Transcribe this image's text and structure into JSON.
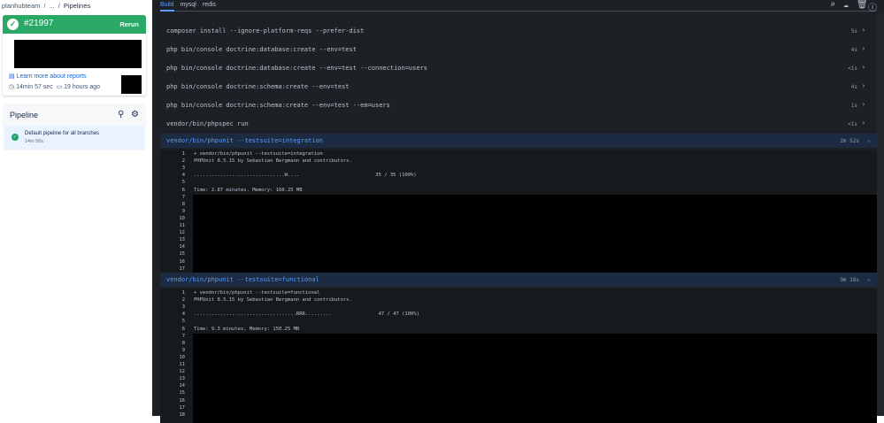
{
  "breadcrumb": [
    "planhubteam",
    "/",
    "...",
    "/",
    "Pipelines"
  ],
  "build": {
    "number": "#21997",
    "rerun": "Rerun",
    "learn": "Learn more about reports",
    "duration": "14min 57 sec",
    "ago": "19 hours ago"
  },
  "pipeline": {
    "title": "Pipeline",
    "item": "Default pipeline for all branches",
    "item_time": "14m 56s"
  },
  "tabs": [
    "Build",
    "mysql",
    "redis"
  ],
  "commands": [
    {
      "cmd": "composer install --ignore-platform-reqs --prefer-dist",
      "dur": "5s"
    },
    {
      "cmd": "php bin/console doctrine:database:create --env=test",
      "dur": "4s"
    },
    {
      "cmd": "php bin/console doctrine:database:create --env=test --connection=users",
      "dur": "<1s"
    },
    {
      "cmd": "php bin/console doctrine:schema:create --env=test",
      "dur": "4s"
    },
    {
      "cmd": "php bin/console doctrine:schema:create --env=test --em=users",
      "dur": "1s"
    },
    {
      "cmd": "vendor/bin/phpspec run",
      "dur": "<1s"
    }
  ],
  "sections": [
    {
      "cmd": "vendor/bin/phpunit --testsuite=integration",
      "dur": "2m 52s",
      "lines": [
        "+ vendor/bin/phpunit --testsuite=integration",
        "PHPUnit 8.5.15 by Sebastian Bergmann and contributors.",
        "",
        "...............................W....                          35 / 35 (100%)",
        "",
        "Time: 2.87 minutes, Memory: 160.25 MB"
      ],
      "count": 17
    },
    {
      "cmd": "vendor/bin/phpunit --testsuite=functional",
      "dur": "9m 18s",
      "lines": [
        "+ vendor/bin/phpunit --testsuite=functional",
        "PHPUnit 8.5.15 by Sebastian Bergmann and contributors.",
        "",
        "...................................RRR.........                47 / 47 (100%)",
        "",
        "Time: 9.3 minutes, Memory: 150.25 MB"
      ],
      "count": 18
    }
  ]
}
